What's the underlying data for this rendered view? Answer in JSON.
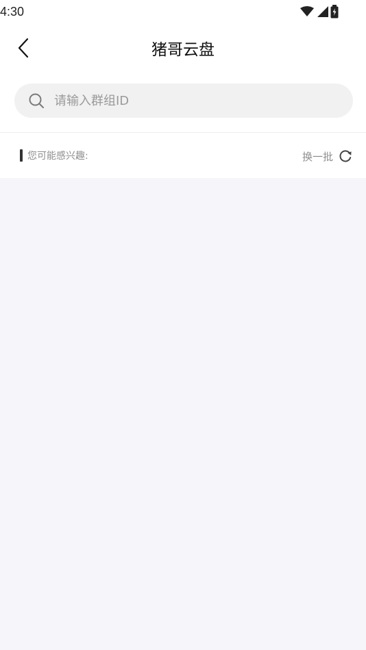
{
  "status_bar": {
    "time": "4:30",
    "icons": [
      "wifi-icon",
      "signal-icon",
      "battery-icon"
    ]
  },
  "header": {
    "title": "猪哥云盘",
    "back_icon": "chevron-left-icon"
  },
  "search": {
    "placeholder": "请输入群组ID",
    "value": "",
    "icon": "search-icon"
  },
  "suggestions": {
    "label": "您可能感兴趣:",
    "refresh_label": "换一批",
    "refresh_icon": "refresh-icon",
    "items": []
  },
  "colors": {
    "header_bg": "#ffffff",
    "page_bg": "#f5f5fa",
    "search_bg": "#f1f1f1",
    "muted_text": "#8e8e8e"
  }
}
